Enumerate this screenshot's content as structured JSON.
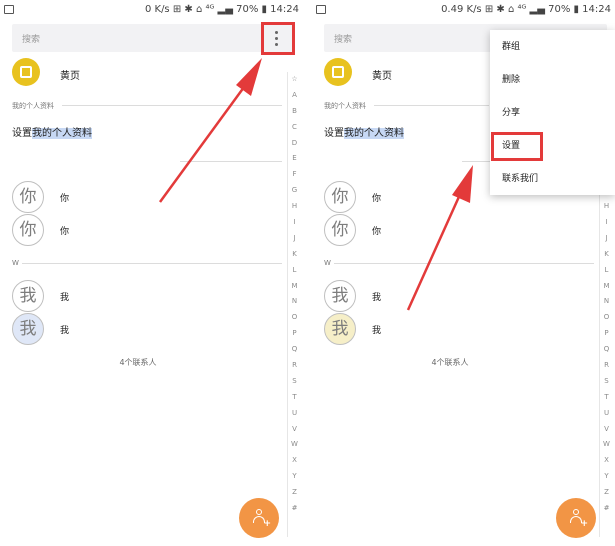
{
  "colors": {
    "accent_red": "#e33a3a",
    "yellow": "#e8c21f",
    "fab_orange": "#f29545",
    "highlight_blue": "#c7d8f4"
  },
  "left": {
    "status": "0 K/s ⊞ ✱ ⌂ ⁴ᴳ ▂▄ 70% ▮ 14:24",
    "search_placeholder": "搜索",
    "yellow_label": "黄页",
    "profile_header": "我的个人资料",
    "profile_prefix": "设置",
    "profile_highlight": "我的个人资料",
    "contacts": [
      {
        "avatar": "你",
        "name": "你"
      },
      {
        "avatar": "你",
        "name": "你"
      },
      {
        "avatar": "我",
        "name": "我"
      },
      {
        "avatar": "我",
        "name": "我"
      }
    ],
    "section_w": "W",
    "count": "4个联系人"
  },
  "right": {
    "status": "0.49 K/s ⊞ ✱ ⌂ ⁴ᴳ ▂▄ 70% ▮ 14:24",
    "search_placeholder": "搜索",
    "yellow_label": "黄页",
    "profile_header": "我的个人资料",
    "profile_prefix": "设置",
    "profile_highlight": "我的个人资料",
    "contacts": [
      {
        "avatar": "你",
        "name": "你"
      },
      {
        "avatar": "你",
        "name": "你"
      },
      {
        "avatar": "我",
        "name": "我"
      },
      {
        "avatar": "我",
        "name": "我"
      }
    ],
    "section_w": "W",
    "count": "4个联系人",
    "menu": [
      "群组",
      "删除",
      "分享",
      "设置",
      "联系我们"
    ]
  },
  "az_index": [
    "☆",
    "A",
    "B",
    "C",
    "D",
    "E",
    "F",
    "G",
    "H",
    "I",
    "J",
    "K",
    "L",
    "M",
    "N",
    "O",
    "P",
    "Q",
    "R",
    "S",
    "T",
    "U",
    "V",
    "W",
    "X",
    "Y",
    "Z",
    "#"
  ],
  "icons": {
    "menu": "more-vert-icon",
    "search": "yellow-pages-icon",
    "fab": "add-contact-icon",
    "gallery": "gallery-icon"
  }
}
